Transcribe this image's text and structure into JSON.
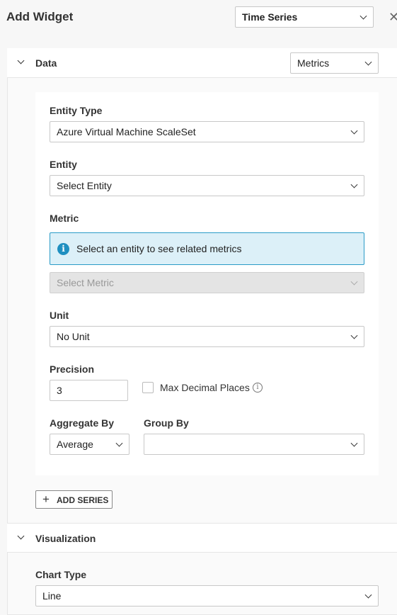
{
  "header": {
    "title": "Add Widget",
    "widget_type": "Time Series",
    "close_glyph": "✕"
  },
  "data_section": {
    "title": "Data",
    "source": "Metrics",
    "entity_type": {
      "label": "Entity Type",
      "value": "Azure Virtual Machine ScaleSet"
    },
    "entity": {
      "label": "Entity",
      "value": "Select Entity"
    },
    "metric": {
      "label": "Metric",
      "info": "Select an entity to see related metrics",
      "placeholder": "Select Metric"
    },
    "unit": {
      "label": "Unit",
      "value": "No Unit"
    },
    "precision": {
      "label": "Precision",
      "value": "3"
    },
    "max_decimal": {
      "label": "Max Decimal Places",
      "checked": false
    },
    "aggregate_by": {
      "label": "Aggregate By",
      "value": "Average"
    },
    "group_by": {
      "label": "Group By",
      "value": ""
    },
    "add_series_label": "ADD SERIES"
  },
  "visualization_section": {
    "title": "Visualization",
    "chart_type": {
      "label": "Chart Type",
      "value": "Line"
    }
  }
}
